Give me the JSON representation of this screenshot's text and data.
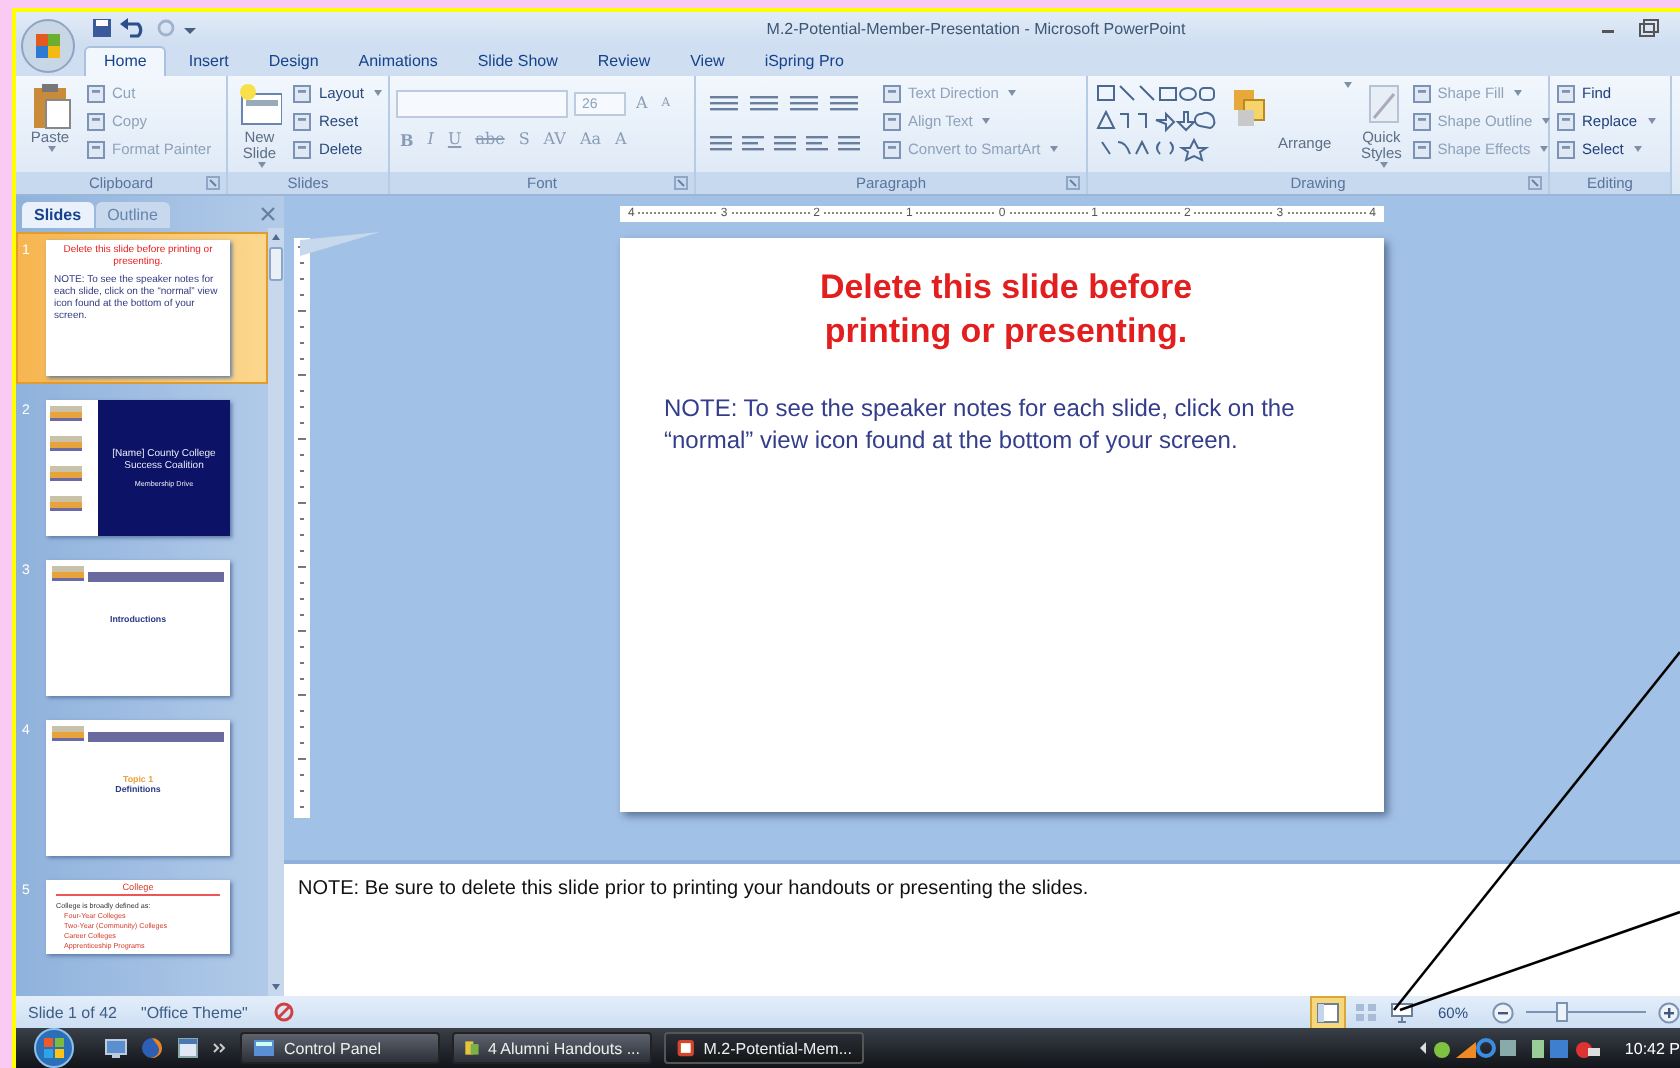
{
  "window": {
    "title": "M.2-Potential-Member-Presentation - Microsoft PowerPoint"
  },
  "ribbon_tabs": [
    {
      "label": "Home",
      "selected": true
    },
    {
      "label": "Insert",
      "selected": false
    },
    {
      "label": "Design",
      "selected": false
    },
    {
      "label": "Animations",
      "selected": false
    },
    {
      "label": "Slide Show",
      "selected": false
    },
    {
      "label": "Review",
      "selected": false
    },
    {
      "label": "View",
      "selected": false
    },
    {
      "label": "iSpring Pro",
      "selected": false
    }
  ],
  "ribbon_groups": [
    {
      "kind": "clipboard",
      "label": "Clipboard",
      "big": [
        {
          "label": "Paste",
          "dropdown": true
        }
      ],
      "items": [
        {
          "label": "Cut",
          "dropdown": false
        },
        {
          "label": "Copy",
          "dropdown": false
        },
        {
          "label": "Format Painter",
          "dropdown": false
        }
      ]
    },
    {
      "kind": "slides",
      "label": "Slides",
      "big": [
        {
          "label": "New Slide",
          "dropdown": true
        }
      ],
      "items": [
        {
          "label": "Layout",
          "dropdown": true
        },
        {
          "label": "Reset",
          "dropdown": false
        },
        {
          "label": "Delete",
          "dropdown": false
        }
      ]
    },
    {
      "kind": "font",
      "label": "Font",
      "size": "26",
      "size_buttons": [
        "A",
        "A"
      ],
      "buttons": [
        "B",
        "I",
        "U",
        "abe",
        "S",
        "AV",
        "Aa",
        "A"
      ]
    },
    {
      "kind": "paragraph",
      "label": "Paragraph",
      "items": [
        {
          "label": "Text Direction",
          "dropdown": true
        },
        {
          "label": "Align Text",
          "dropdown": true
        },
        {
          "label": "Convert to SmartArt",
          "dropdown": true
        }
      ]
    },
    {
      "kind": "drawing",
      "label": "Drawing",
      "big": [
        {
          "label": "Arrange",
          "dropdown": true
        },
        {
          "label": "Quick Styles",
          "dropdown": true
        }
      ],
      "items": [
        {
          "label": "Shape Fill",
          "dropdown": true
        },
        {
          "label": "Shape Outline",
          "dropdown": true
        },
        {
          "label": "Shape Effects",
          "dropdown": true
        }
      ]
    },
    {
      "kind": "editing",
      "label": "Editing",
      "items": [
        {
          "label": "Find",
          "dropdown": false
        },
        {
          "label": "Replace",
          "dropdown": true
        },
        {
          "label": "Select",
          "dropdown": true
        }
      ]
    }
  ],
  "panel_tabs": [
    {
      "label": "Slides",
      "selected": true
    },
    {
      "label": "Outline",
      "selected": false
    }
  ],
  "thumbnails": [
    {
      "number": "1",
      "kind": "notice",
      "selected": true,
      "title": "Delete this slide  before printing or presenting.",
      "body": "NOTE:  To see the speaker notes for each slide, click on the “normal” view icon found at the bottom of your screen."
    },
    {
      "number": "2",
      "kind": "cover",
      "selected": false,
      "title": "[Name] County College Success Coalition",
      "subtitle": "Membership Drive"
    },
    {
      "number": "3",
      "kind": "section",
      "selected": false,
      "title": "Introductions"
    },
    {
      "number": "4",
      "kind": "section",
      "selected": false,
      "topic": "Topic 1",
      "title": "Definitions"
    },
    {
      "number": "5",
      "kind": "bullets",
      "selected": false,
      "title": "College",
      "body": "College is broadly defined as:",
      "bullets": [
        "Four-Year Colleges",
        "Two-Year (Community) Colleges",
        "Career Colleges",
        "Apprenticeship Programs"
      ]
    }
  ],
  "ruler": [
    "4",
    "3",
    "2",
    "1",
    "0",
    "1",
    "2",
    "3",
    "4"
  ],
  "slide": {
    "title": "Delete this slide before printing or presenting.",
    "body": "NOTE:  To see the speaker notes for each slide, click on the “normal” view icon found at the bottom of your screen."
  },
  "notes": "NOTE:  Be sure to delete this slide prior to printing your handouts or presenting the slides.",
  "status_bar": {
    "slide_count": "Slide 1 of 42",
    "theme": "\"Office Theme\"",
    "views": [
      {
        "kind": "normal",
        "selected": true
      },
      {
        "kind": "sorter",
        "selected": false
      },
      {
        "kind": "show",
        "selected": false
      }
    ],
    "zoom": "60%",
    "zoom_slider": {
      "level": 0.3
    }
  },
  "taskbar": {
    "buttons": [
      {
        "label": "Control Panel",
        "selected": false
      },
      {
        "label": "4 Alumni Handouts ...",
        "selected": false
      },
      {
        "label": "M.2-Potential-Mem...",
        "selected": true
      }
    ],
    "clock": "10:42 P"
  }
}
